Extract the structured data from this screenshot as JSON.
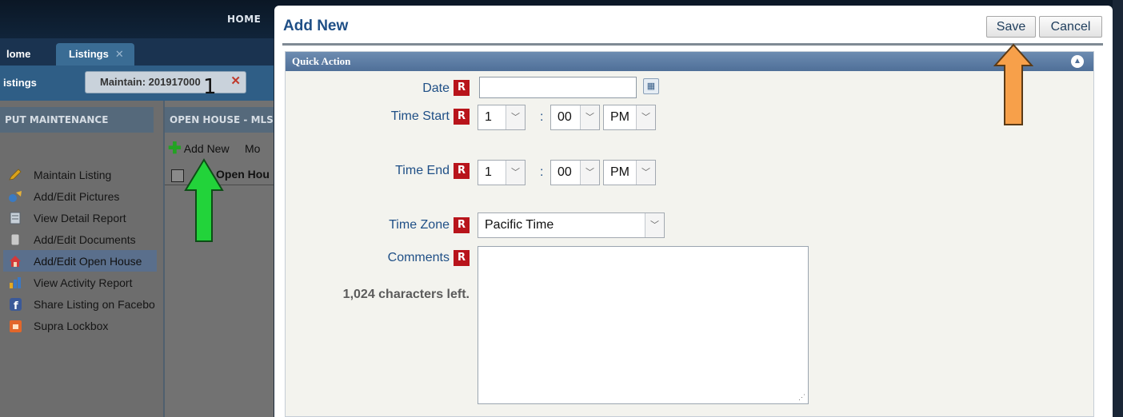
{
  "background_app": {
    "top_nav": {
      "home": "HOME"
    },
    "tabs": [
      {
        "label": "Home",
        "visible_text": "lome"
      },
      {
        "label": "Listings",
        "close": "✕"
      }
    ],
    "sub_bar": {
      "listings": "istings",
      "maintain_tab": "Maintain: 201917000",
      "maintain_close": "✕"
    },
    "annotation_number": "1",
    "left_panel": {
      "header": "PUT MAINTENANCE",
      "items": [
        {
          "label": "Maintain Listing",
          "icon": "pencil-icon",
          "color": "#d9a21b"
        },
        {
          "label": "Add/Edit Pictures",
          "icon": "pictures-icon",
          "color": "#3a7ac2"
        },
        {
          "label": "View Detail Report",
          "icon": "report-icon",
          "color": "#c7d0d9"
        },
        {
          "label": "Add/Edit Documents",
          "icon": "document-icon",
          "color": "#c9c9c9"
        },
        {
          "label": "Add/Edit Open House",
          "icon": "open-house-icon",
          "color": "#d23a3a",
          "active": true
        },
        {
          "label": "View Activity Report",
          "icon": "activity-chart-icon",
          "color": "#3b78c4"
        },
        {
          "label": "Share Listing on Facebo",
          "icon": "facebook-icon",
          "color": "#3b5998"
        },
        {
          "label": "Supra Lockbox",
          "icon": "lockbox-icon",
          "color": "#e2662a"
        }
      ]
    },
    "middle_panel": {
      "header": "OPEN HOUSE - MLS",
      "add_new": "Add New",
      "more": "Mo",
      "column_header": "Open Hou"
    }
  },
  "modal": {
    "title": "Add New",
    "save_label": "Save",
    "cancel_label": "Cancel",
    "section_title": "Quick Action",
    "required_marker": "R",
    "fields": {
      "date": {
        "label": "Date",
        "value": ""
      },
      "time_start": {
        "label": "Time Start",
        "hour": "1",
        "separator": ":",
        "minute": "00",
        "ampm": "PM"
      },
      "time_end": {
        "label": "Time End",
        "hour": "1",
        "separator": ":",
        "minute": "00",
        "ampm": "PM"
      },
      "time_zone": {
        "label": "Time Zone",
        "value": "Pacific Time"
      },
      "comments": {
        "label": "Comments",
        "value": "",
        "chars_left": "1,024 characters left."
      }
    }
  },
  "annotations": {
    "green_arrow_color": "#22d33a",
    "orange_arrow_color": "#f7a04a"
  },
  "colors": {
    "title_blue": "#1f4f86",
    "required_red": "#b8141b",
    "panel_header": "#5b7ba3"
  }
}
